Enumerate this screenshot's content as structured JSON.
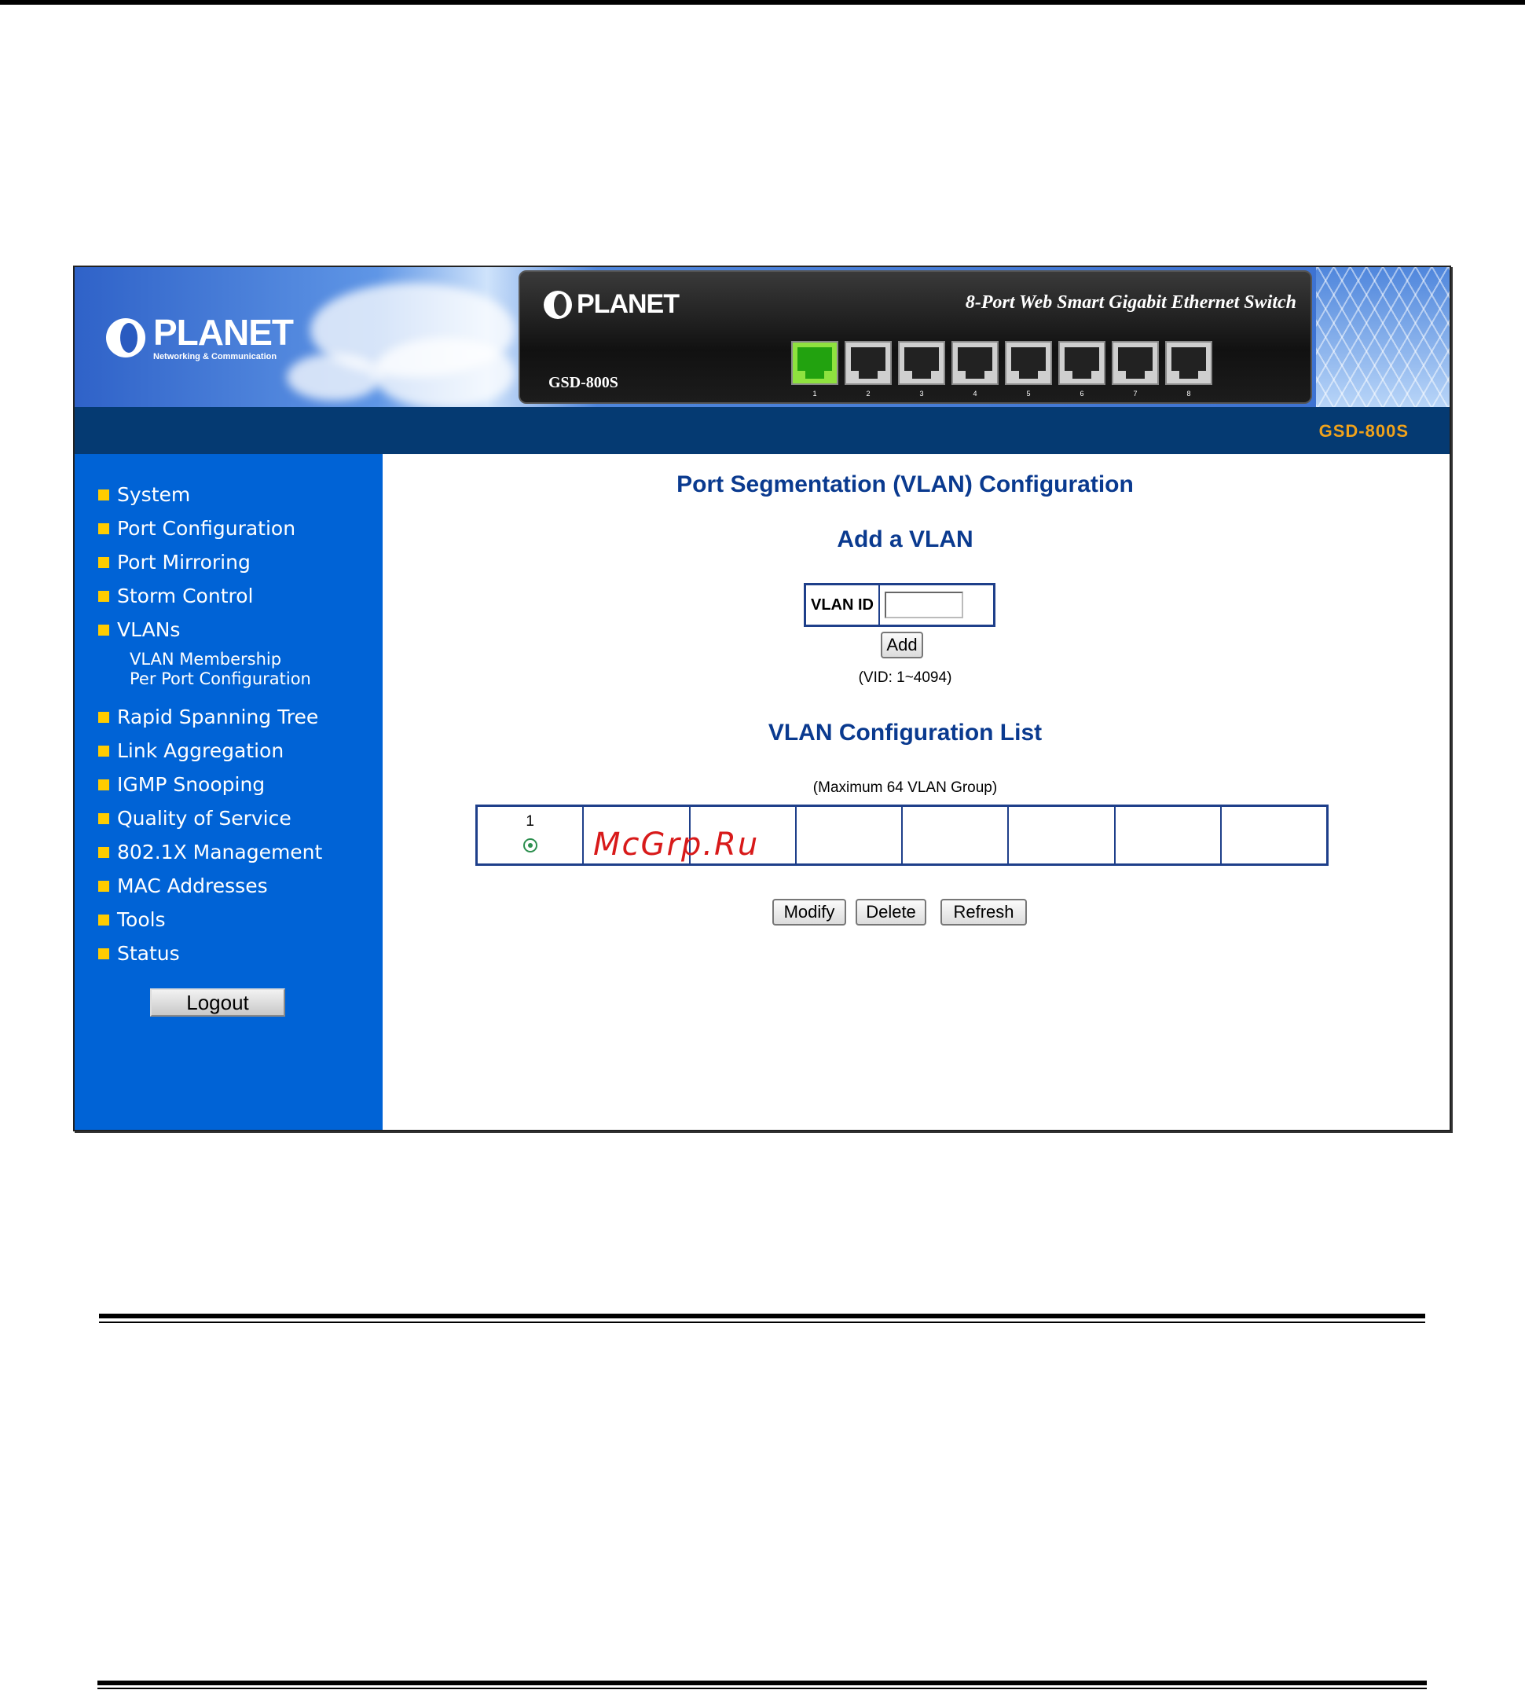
{
  "brand": {
    "name": "PLANET",
    "tagline": "Networking & Communication"
  },
  "device": {
    "title": "8-Port Web Smart Gigabit Ethernet Switch",
    "model": "GSD-800S",
    "ports": [
      {
        "num": "1",
        "active": true
      },
      {
        "num": "2",
        "active": false
      },
      {
        "num": "3",
        "active": false
      },
      {
        "num": "4",
        "active": false
      },
      {
        "num": "5",
        "active": false
      },
      {
        "num": "6",
        "active": false
      },
      {
        "num": "7",
        "active": false
      },
      {
        "num": "8",
        "active": false
      }
    ]
  },
  "model_bar": {
    "label": "GSD-800S"
  },
  "sidebar": {
    "items": [
      {
        "label": "System"
      },
      {
        "label": "Port Configuration"
      },
      {
        "label": "Port Mirroring"
      },
      {
        "label": "Storm Control"
      },
      {
        "label": "VLANs"
      },
      {
        "label": "Rapid Spanning Tree"
      },
      {
        "label": "Link Aggregation"
      },
      {
        "label": "IGMP Snooping"
      },
      {
        "label": "Quality of Service"
      },
      {
        "label": "802.1X Management"
      },
      {
        "label": "MAC Addresses"
      },
      {
        "label": "Tools"
      },
      {
        "label": "Status"
      }
    ],
    "vlan_sub": [
      "VLAN Membership",
      "Per Port Configuration"
    ],
    "logout_label": "Logout"
  },
  "main": {
    "title": "Port Segmentation (VLAN) Configuration",
    "add_heading": "Add a VLAN",
    "vid_label": "VLAN ID",
    "vid_value": "",
    "add_label": "Add",
    "vid_hint": "(VID: 1~4094)",
    "list_heading": "VLAN Configuration List",
    "max_hint": "(Maximum 64 VLAN Group)",
    "vlan_list": [
      "1",
      "",
      "",
      "",
      "",
      "",
      "",
      ""
    ],
    "modify_label": "Modify",
    "delete_label": "Delete",
    "refresh_label": "Refresh"
  },
  "watermark": "McGrp.Ru",
  "colors": {
    "accent": "#0063d6",
    "bar": "#053a72",
    "bullet": "#ffcc00",
    "model_text": "#f0a21b",
    "heading": "#0a3a8f"
  }
}
